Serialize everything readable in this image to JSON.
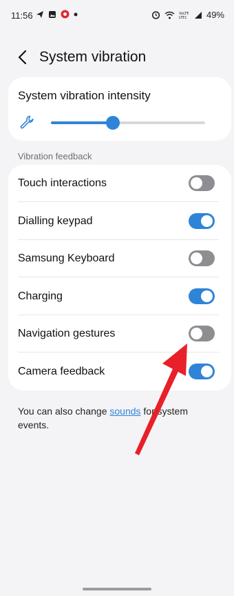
{
  "status_bar": {
    "time": "11:56",
    "left_icons": [
      "telegram-icon",
      "gallery-icon",
      "record-icon",
      "dot-icon"
    ],
    "right_icons": [
      "alarm-icon",
      "wifi-icon",
      "volte-icon",
      "signal-icon"
    ],
    "battery": "49%"
  },
  "header": {
    "title": "System vibration"
  },
  "intensity": {
    "title": "System vibration intensity",
    "level": 0.4,
    "accent": "#2f84d8"
  },
  "section": {
    "label": "Vibration feedback"
  },
  "settings": [
    {
      "label": "Touch interactions",
      "on": false
    },
    {
      "label": "Dialling keypad",
      "on": true
    },
    {
      "label": "Samsung Keyboard",
      "on": false
    },
    {
      "label": "Charging",
      "on": true
    },
    {
      "label": "Navigation gestures",
      "on": false
    },
    {
      "label": "Camera feedback",
      "on": true
    }
  ],
  "footer": {
    "text_before": "You can also change ",
    "link": "sounds",
    "text_after": " for system events."
  },
  "annotation": {
    "color": "#e8202a"
  }
}
